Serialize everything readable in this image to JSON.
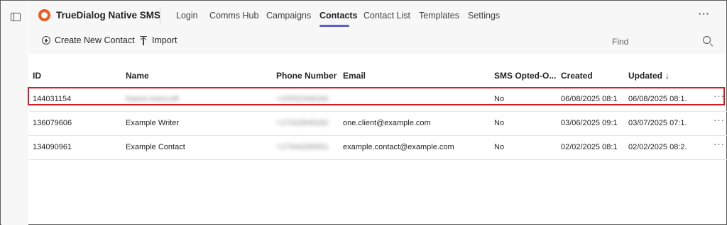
{
  "app": {
    "title": "TrueDialog Native SMS",
    "logo_color": "#f05a1f",
    "accent_color": "#5b5fc7",
    "highlight_color": "#d71920"
  },
  "tabs": [
    {
      "label": "Login",
      "active": false
    },
    {
      "label": "Comms Hub",
      "active": false
    },
    {
      "label": "Campaigns",
      "active": false
    },
    {
      "label": "Contacts",
      "active": true
    },
    {
      "label": "Contact List",
      "active": false
    },
    {
      "label": "Templates",
      "active": false
    },
    {
      "label": "Settings",
      "active": false
    }
  ],
  "topbar": {
    "more_label": "···"
  },
  "toolbar": {
    "create_label": "Create New Contact",
    "import_label": "Import",
    "find_label": "Find"
  },
  "table": {
    "columns": [
      "ID",
      "Name",
      "Phone Number",
      "Email",
      "SMS Opted-O...",
      "Created",
      "Updated"
    ],
    "sort_indicator": "↓",
    "row_more_label": "···",
    "rows": [
      {
        "id": "144031154",
        "name": "Naomi Ashcroft",
        "phone": "+15552348160",
        "email": "",
        "sms_opted_out": "No",
        "created": "06/08/2025 08:1...",
        "updated": "06/08/2025 08:1...",
        "highlighted": true
      },
      {
        "id": "136079606",
        "name": "Example Writer",
        "phone": "+17022849182",
        "email": "one.client@example.com",
        "sms_opted_out": "No",
        "created": "03/06/2025 09:1...",
        "updated": "03/07/2025 07:1...",
        "highlighted": false
      },
      {
        "id": "134090961",
        "name": "Example Contact",
        "phone": "+17044289951",
        "email": "example.contact@example.com",
        "sms_opted_out": "No",
        "created": "02/02/2025 08:1...",
        "updated": "02/02/2025 08:2...",
        "highlighted": false
      }
    ]
  }
}
